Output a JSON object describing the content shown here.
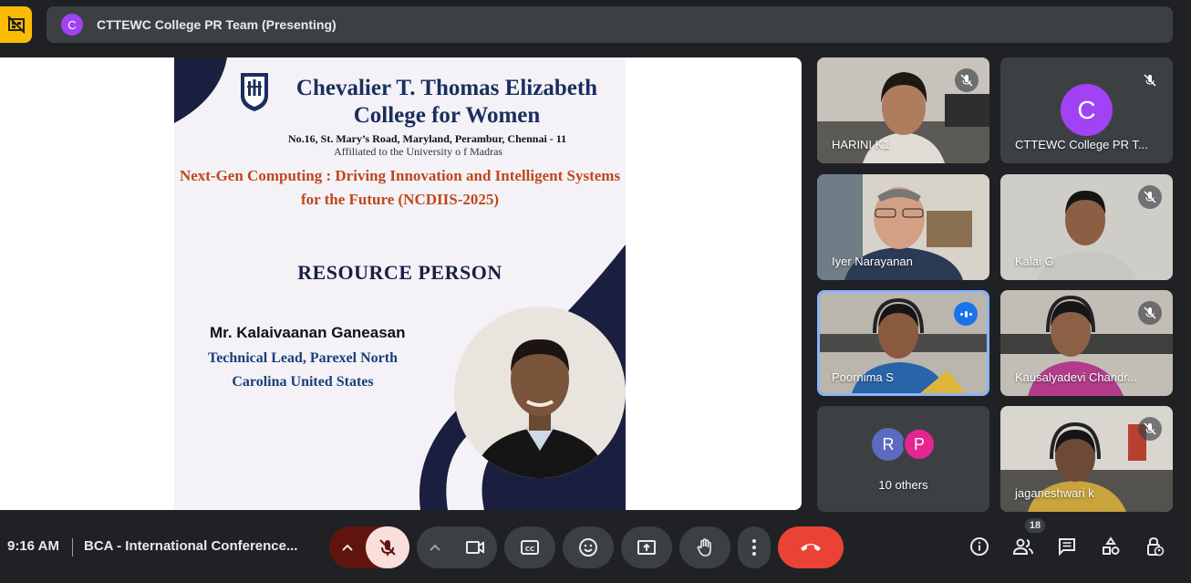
{
  "presenter_bar": {
    "avatar_letter": "C",
    "text": "CTTEWC College PR Team (Presenting)"
  },
  "slide": {
    "college_name": "Chevalier T. Thomas Elizabeth College for Women",
    "address": "No.16, St. Mary’s Road, Maryland, Perambur, Chennai - 11",
    "affiliation": "Affiliated to the University o f Madras",
    "theme": "Next-Gen Computing : Driving Innovation and Intelligent Systems for the Future (NCDIIS-2025)",
    "section_title": "RESOURCE PERSON",
    "speaker_name": "Mr. Kalaivaanan Ganeasan",
    "speaker_role": "Technical Lead, Parexel North Carolina United States"
  },
  "participants": [
    {
      "name": "HARINI K1",
      "muted": true
    },
    {
      "name": "CTTEWC College PR T...",
      "avatar_letter": "C",
      "muted": true
    },
    {
      "name": "Iyer Narayanan",
      "muted": false
    },
    {
      "name": "Kalai G",
      "muted": true
    },
    {
      "name": "Poornima S",
      "speaking": true
    },
    {
      "name": "Kausalyadevi Chandr...",
      "muted": true
    },
    {
      "others_letters": [
        "R",
        "P"
      ],
      "label": "10 others"
    },
    {
      "name": "jaganeshwari k",
      "muted": true
    }
  ],
  "bottom_bar": {
    "time": "9:16 AM",
    "meeting_title": "BCA - International Conference...",
    "participant_count": "18"
  },
  "colors": {
    "end_call": "#ea4335",
    "accent_blue": "#8ab4f8",
    "layout_button": "#fbbc04"
  }
}
